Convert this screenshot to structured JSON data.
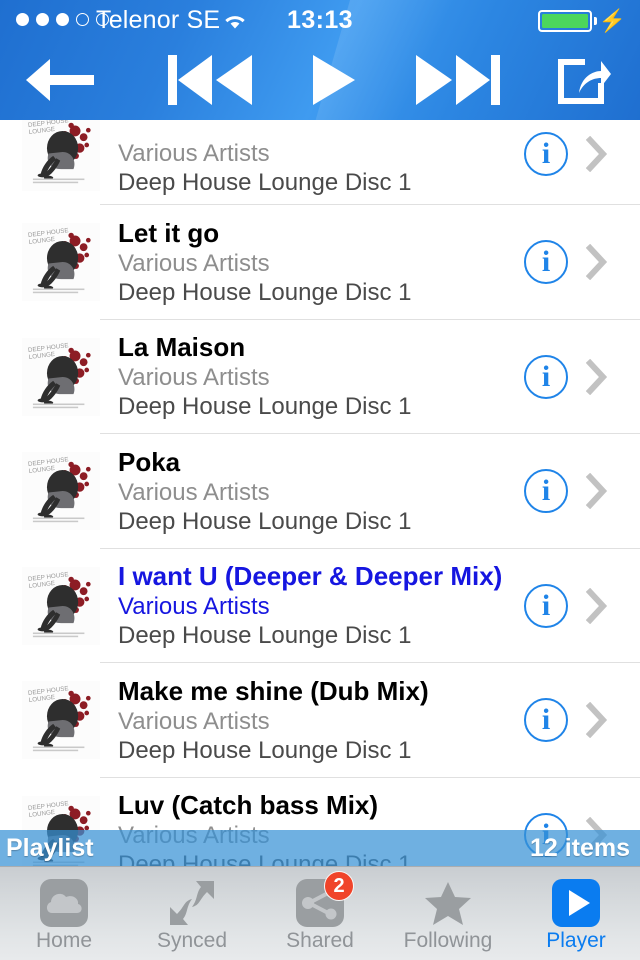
{
  "status_bar": {
    "signal_dots_filled": 3,
    "signal_dots_total": 5,
    "carrier": "Telenor SE",
    "wifi_icon": "wifi-icon",
    "time": "13:13",
    "battery_icon": "battery-full-icon",
    "charging_icon": "lightning-bolt-icon",
    "battery_color": "#4cd65c"
  },
  "nav_bar": {
    "background_color": "#2a7fdd",
    "buttons": [
      {
        "name": "back-button",
        "icon": "arrow-left-icon"
      },
      {
        "name": "previous-button",
        "icon": "skip-backward-icon"
      },
      {
        "name": "play-button",
        "icon": "play-icon"
      },
      {
        "name": "next-button",
        "icon": "skip-forward-icon"
      },
      {
        "name": "share-button",
        "icon": "share-icon"
      }
    ]
  },
  "list": {
    "album_art_alt": "Deep House Lounge album cover",
    "info_glyph": "i",
    "accent_color": "#1f84e8",
    "active_color": "#1616e0",
    "rows": [
      {
        "title": "",
        "artist": "Various Artists",
        "album": "Deep House Lounge Disc 1",
        "active": false,
        "clipped": true
      },
      {
        "title": "Let it go",
        "artist": "Various Artists",
        "album": "Deep House Lounge Disc 1",
        "active": false
      },
      {
        "title": "La Maison",
        "artist": "Various Artists",
        "album": "Deep House Lounge Disc 1",
        "active": false
      },
      {
        "title": "Poka",
        "artist": "Various Artists",
        "album": "Deep House Lounge Disc 1",
        "active": false
      },
      {
        "title": "I want U (Deeper & Deeper Mix)",
        "artist": "Various Artists",
        "album": "Deep House Lounge Disc 1",
        "active": true
      },
      {
        "title": "Make me shine (Dub Mix)",
        "artist": "Various Artists",
        "album": "Deep House Lounge Disc 1",
        "active": false
      },
      {
        "title": "Luv (Catch bass Mix)",
        "artist": "Various Artists",
        "album": "Deep House Lounge Disc 1",
        "active": false
      }
    ]
  },
  "playlist_bar": {
    "left_label": "Playlist",
    "right_label": "12 items",
    "background_color": "#3891d6"
  },
  "tab_bar": {
    "items": [
      {
        "label": "Home",
        "icon": "cloud-icon",
        "selected": false,
        "badge": null
      },
      {
        "label": "Synced",
        "icon": "sync-arrows-icon",
        "selected": false,
        "badge": null
      },
      {
        "label": "Shared",
        "icon": "share-nodes-icon",
        "selected": false,
        "badge": "2"
      },
      {
        "label": "Following",
        "icon": "star-icon",
        "selected": false,
        "badge": null
      },
      {
        "label": "Player",
        "icon": "play-square-icon",
        "selected": true,
        "badge": null
      }
    ],
    "selected_color": "#0a7cf0",
    "badge_color": "#f0442a"
  }
}
